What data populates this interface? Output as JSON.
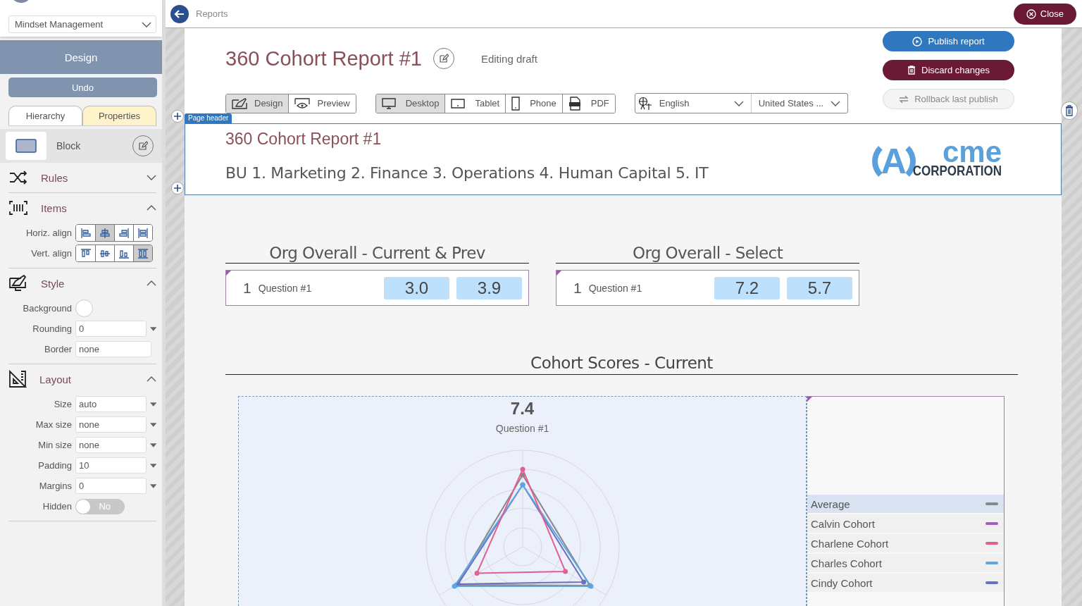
{
  "sidebar": {
    "account_select": "Mindset Management",
    "mode_header": "Design",
    "undo": "Undo",
    "tabs": [
      {
        "label": "Hierarchy",
        "selected": false
      },
      {
        "label": "Properties",
        "selected": true
      }
    ],
    "element": {
      "label": "Block"
    },
    "sections": [
      {
        "title": "Rules",
        "expanded": false
      },
      {
        "title": "Items",
        "expanded": true,
        "fields": [
          {
            "kind": "halign",
            "label": "Horiz. align",
            "options": [
              {
                "selected": false
              },
              {
                "selected": true
              },
              {
                "selected": false
              },
              {
                "selected": false
              }
            ]
          },
          {
            "kind": "valign",
            "label": "Vert. align",
            "options": [
              {
                "selected": false
              },
              {
                "selected": false
              },
              {
                "selected": false
              },
              {
                "selected": true
              }
            ]
          }
        ]
      },
      {
        "title": "Style",
        "expanded": true,
        "fields": [
          {
            "kind": "color",
            "label": "Background"
          },
          {
            "kind": "input",
            "label": "Rounding",
            "value": "0"
          },
          {
            "kind": "select",
            "label": "Border",
            "value": "none"
          }
        ]
      },
      {
        "title": "Layout",
        "expanded": true,
        "fields": [
          {
            "kind": "input",
            "label": "Size",
            "value": "auto"
          },
          {
            "kind": "input",
            "label": "Max size",
            "value": "none"
          },
          {
            "kind": "input",
            "label": "Min size",
            "value": "none"
          },
          {
            "kind": "input",
            "label": "Padding",
            "value": "10"
          },
          {
            "kind": "input",
            "label": "Margins",
            "value": "0"
          },
          {
            "kind": "toggle",
            "label": "Hidden",
            "on": false,
            "value": "No"
          }
        ]
      }
    ]
  },
  "top_bar": {
    "breadcrumb": "Reports",
    "close": "Close"
  },
  "report": {
    "title": "360 Cohort Report #1",
    "status": "Editing draft"
  },
  "view_modes": [
    {
      "label": "Design",
      "selected": true
    },
    {
      "label": "Preview",
      "selected": false
    }
  ],
  "devices": [
    {
      "label": "Desktop",
      "selected": true
    },
    {
      "label": "Tablet",
      "selected": false
    },
    {
      "label": "Phone",
      "selected": false
    },
    {
      "label": "PDF",
      "selected": false
    }
  ],
  "language": {
    "value": "English"
  },
  "region": {
    "value": "United States ..."
  },
  "actions": [
    {
      "label": "Publish report",
      "kind": "primary",
      "disabled": false
    },
    {
      "label": "Discard changes",
      "kind": "danger",
      "disabled": false
    },
    {
      "label": "Rollback last publish",
      "kind": "secondary",
      "disabled": true
    }
  ],
  "page_header": {
    "tag": "Page header",
    "title": "360 Cohort Report #1",
    "subtitle": "BU 1. Marketing 2. Finance 3. Operations 4. Human Capital 5. IT",
    "logo": {
      "mark": "A",
      "word": "cme",
      "tagline": "CORPORATION"
    }
  },
  "score_cards": [
    {
      "title": "Org Overall - Current & Prev",
      "rows": [
        {
          "number": "1",
          "label": "Question #1",
          "scores": [
            "3.0",
            "3.9"
          ]
        }
      ]
    },
    {
      "title": "Org Overall - Select",
      "rows": [
        {
          "number": "1",
          "label": "Question #1",
          "scores": [
            "7.2",
            "5.7"
          ]
        }
      ]
    }
  ],
  "cohort": {
    "title": "Cohort Scores - Current",
    "score": "7.4",
    "question": "Question #1",
    "legend": [
      {
        "name": "Average",
        "color": "#888888",
        "selected": true
      },
      {
        "name": "Calvin Cohort",
        "color": "#a05cc0",
        "selected": false
      },
      {
        "name": "Charlene Cohort",
        "color": "#e0608f",
        "selected": false
      },
      {
        "name": "Charles Cohort",
        "color": "#5aa8e6",
        "selected": false
      },
      {
        "name": "Cindy Cohort",
        "color": "#6a70c0",
        "selected": false
      }
    ]
  }
}
